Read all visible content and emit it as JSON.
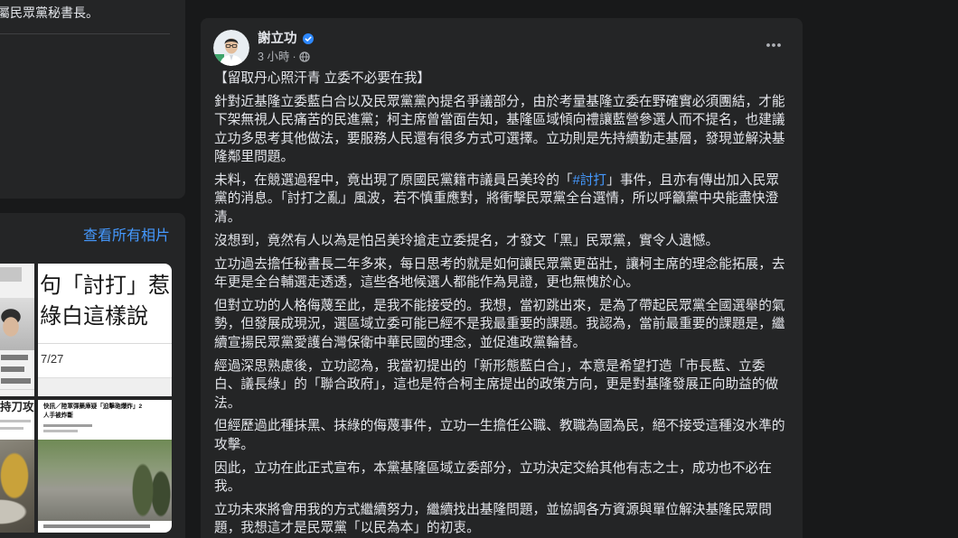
{
  "theme": {
    "page_background": "#18191a",
    "card_background": "#242526",
    "primary_text": "#e4e6eb",
    "secondary_text": "#b0b3b8",
    "link": "#4599ff",
    "verified_badge": "#2d88ff"
  },
  "sidebar": {
    "intro": {
      "text": "屬民眾黨秘書長。"
    },
    "photos": {
      "see_all_label": "查看所有相片",
      "thumbnails": [
        {
          "headline_lines": []
        },
        {
          "headline_lines": [
            "句「討打」惹",
            "綠白這樣說"
          ],
          "date": "7/27"
        },
        {
          "headline_lines": [
            "持刀攻"
          ]
        },
        {
          "headline_lines": [
            "快訊／陸軍彈藥庫疑「迫擊砲爆炸」2",
            "人手被炸斷"
          ]
        }
      ]
    }
  },
  "post": {
    "author": "謝立功",
    "verified_icon": "verified-badge-icon",
    "timestamp": "3 小時",
    "separator": "·",
    "audience_icon": "globe-icon",
    "more_icon": "more-horizontal-icon",
    "paragraphs": [
      {
        "lines": [
          "【留取丹心照汗青 立委不必要在我】"
        ]
      },
      {
        "lines": [
          "針對近基隆立委藍白合以及民眾黨黨內提名爭議部分，由於考量基隆立委在野確實必須團結，才能",
          "下架無視人民痛苦的民進黨；柯主席曾當面告知，基隆區域傾向禮讓藍營參選人而不提名，也建議",
          "立功多思考其他做法，要服務人民還有很多方式可選擇。立功則是先持續勤走基層，發現並解決基",
          "隆鄰里問題。"
        ]
      },
      {
        "lines": [
          {
            "before": "未料，在競選過程中，竟出現了原國民黨籍市議員呂美玲的「",
            "hashtag": "#討打",
            "after": "」事件，且亦有傳出加入民眾"
          },
          "黨的消息。「討打之亂」風波，若不慎重應對，將衝擊民眾黨全台選情，所以呼籲黨中央能盡快澄",
          "清。"
        ]
      },
      {
        "lines": [
          "沒想到，竟然有人以為是怕呂美玲搶走立委提名，才發文「黑」民眾黨，實令人遺憾。"
        ]
      },
      {
        "lines": [
          "立功過去擔任秘書長二年多來，每日思考的就是如何讓民眾黨更茁壯，讓柯主席的理念能拓展，去",
          "年更是全台輔選走透透，這些各地候選人都能作為見證，更也無愧於心。"
        ]
      },
      {
        "lines": [
          "但對立功的人格侮蔑至此，是我不能接受的。我想，當初跳出來，是為了帶起民眾黨全國選舉的氣",
          "勢，但發展成現況，選區域立委可能已經不是我最重要的課題。我認為，當前最重要的課題是，繼",
          "續宣揚民眾黨愛護台灣保衛中華民國的理念，並促進政黨輪替。"
        ]
      },
      {
        "lines": [
          "經過深思熟慮後，立功認為，我當初提出的「新形態藍白合」，本意是希望打造「市長藍、立委",
          "白、議長綠」的「聯合政府」，這也是符合柯主席提出的政策方向，更是對基隆發展正向助益的做",
          "法。"
        ]
      },
      {
        "lines": [
          "但經歷過此種抹黑、抹綠的侮蔑事件，立功一生擔任公職、教職為國為民，絕不接受這種沒水準的",
          "攻擊。"
        ]
      },
      {
        "lines": [
          "因此，立功在此正式宣布，本黨基隆區域立委部分，立功決定交給其他有志之士，成功也不必在",
          "我。"
        ]
      },
      {
        "lines": [
          "立功未來將會用我的方式繼續努力，繼續找出基隆問題，並協調各方資源與單位解決基隆民眾問",
          "題，我想這才是民眾黨「以民為本」的初衷。"
        ]
      }
    ]
  }
}
